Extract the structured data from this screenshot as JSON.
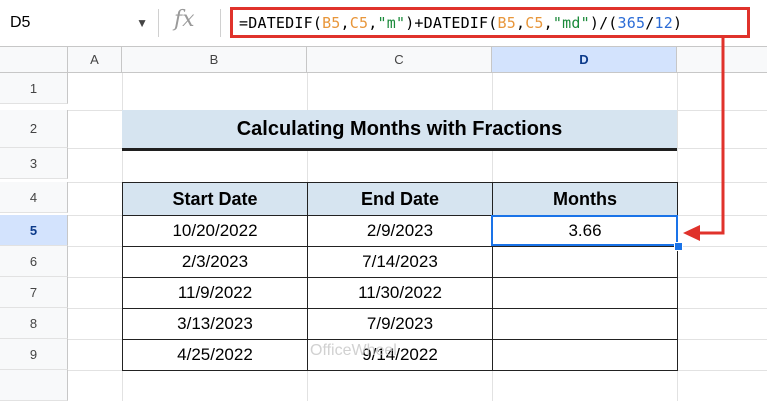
{
  "namebox": {
    "ref": "D5"
  },
  "formula_bar": {
    "fx_label": "fx",
    "segments": [
      {
        "text": "=DATEDIF(",
        "color": "#000000"
      },
      {
        "text": "B5",
        "color": "#e8963a"
      },
      {
        "text": ",",
        "color": "#000000"
      },
      {
        "text": "C5",
        "color": "#e8963a"
      },
      {
        "text": ",",
        "color": "#000000"
      },
      {
        "text": "\"m\"",
        "color": "#1a8a3a"
      },
      {
        "text": ")+DATEDIF(",
        "color": "#000000"
      },
      {
        "text": "B5",
        "color": "#e8963a"
      },
      {
        "text": ",",
        "color": "#000000"
      },
      {
        "text": "C5",
        "color": "#e8963a"
      },
      {
        "text": ",",
        "color": "#000000"
      },
      {
        "text": "\"md\"",
        "color": "#1a8a3a"
      },
      {
        "text": ")/(",
        "color": "#000000"
      },
      {
        "text": "365",
        "color": "#2a6bd6"
      },
      {
        "text": "/",
        "color": "#000000"
      },
      {
        "text": "12",
        "color": "#2a6bd6"
      },
      {
        "text": ")",
        "color": "#000000"
      }
    ]
  },
  "columns": [
    "A",
    "B",
    "C",
    "D"
  ],
  "rows": [
    "1",
    "2",
    "3",
    "4",
    "5",
    "6",
    "7",
    "8",
    "9"
  ],
  "selected_cell": "D5",
  "title": "Calculating Months with Fractions",
  "table": {
    "headers": [
      "Start Date",
      "End Date",
      "Months"
    ],
    "rows": [
      [
        "10/20/2022",
        "2/9/2023",
        "3.66"
      ],
      [
        "2/3/2023",
        "7/14/2023",
        ""
      ],
      [
        "11/9/2022",
        "11/30/2022",
        ""
      ],
      [
        "3/13/2023",
        "7/9/2023",
        ""
      ],
      [
        "4/25/2022",
        "9/14/2022",
        ""
      ]
    ]
  },
  "watermark": "OfficeWheel",
  "colors": {
    "accent_red": "#e0322b",
    "selection_blue": "#1a73e8",
    "header_fill": "#d6e4f0"
  }
}
